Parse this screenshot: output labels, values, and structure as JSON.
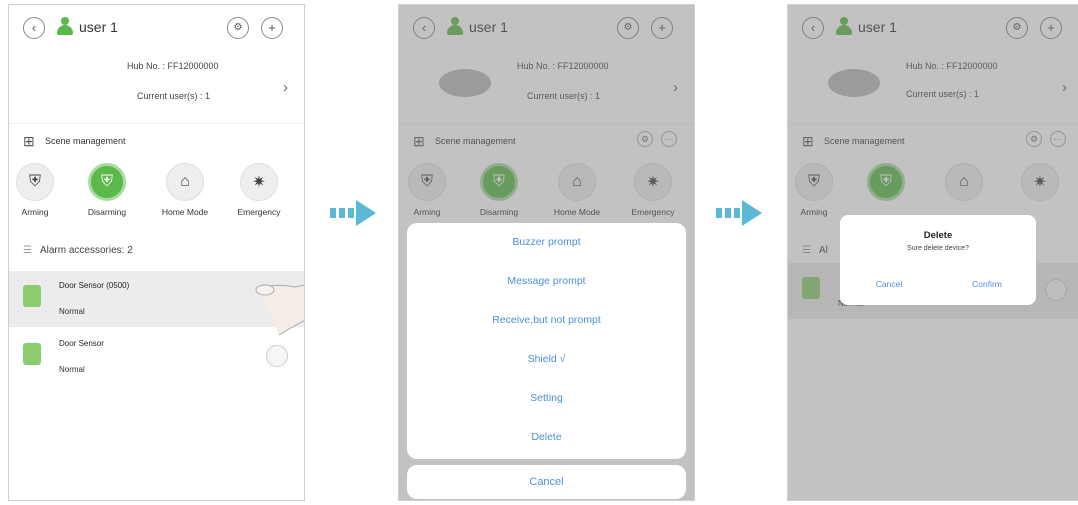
{
  "colors": {
    "accent": "#5bb84a",
    "link": "#4a90d9",
    "arrow": "#5ab8d8"
  },
  "header": {
    "back_icon": "chevron-left-icon",
    "user_name": "user 1",
    "hub_label": "Hub No. : FF12000000",
    "users_label": "Current user(s) : 1"
  },
  "scene": {
    "title": "Scene management"
  },
  "modes": [
    {
      "label": "Arming",
      "icon": "shield-lock-icon"
    },
    {
      "label": "Disarming",
      "icon": "shield-open-icon"
    },
    {
      "label": "Home Mode",
      "icon": "home-icon"
    },
    {
      "label": "Emergency",
      "icon": "siren-icon"
    }
  ],
  "accessories": {
    "header": "Alarm accessories: 2"
  },
  "devices": [
    {
      "name": "Door Sensor (0500)",
      "status": "Normal"
    },
    {
      "name": "Door Sensor",
      "status": "Normal"
    }
  ],
  "sheet": {
    "items": [
      "Buzzer prompt",
      "Message prompt",
      "Receive,but not prompt",
      "Shield √",
      "Setting",
      "Delete"
    ],
    "cancel": "Cancel"
  },
  "dialog": {
    "title": "Delete",
    "message": "Sure delete device?",
    "cancel": "Cancel",
    "confirm": "Confirm"
  },
  "screen3": {
    "acc_short": "Al"
  }
}
